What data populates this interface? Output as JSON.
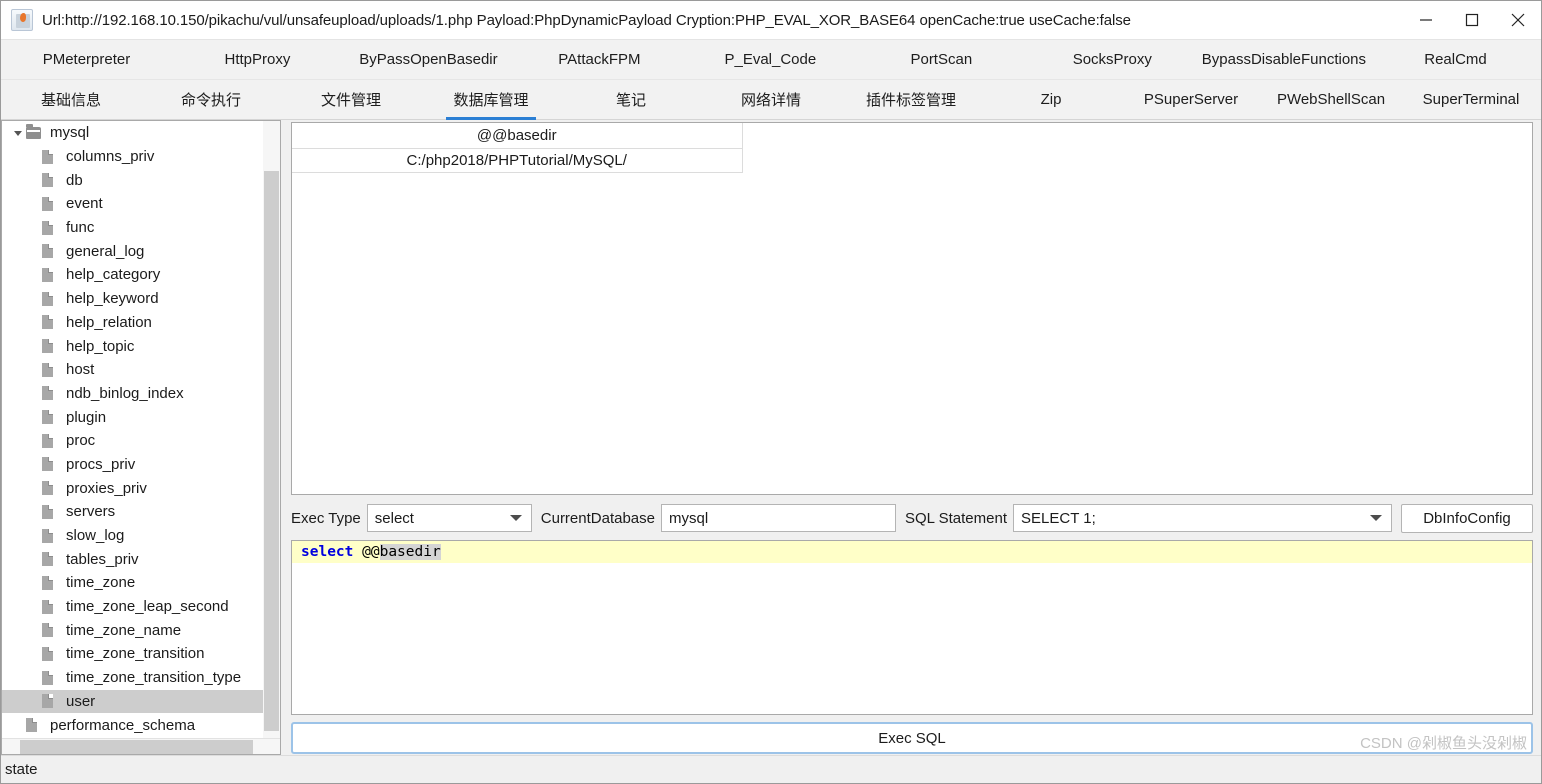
{
  "window": {
    "title": "Url:http://192.168.10.150/pikachu/vul/unsafeupload/uploads/1.php Payload:PhpDynamicPayload Cryption:PHP_EVAL_XOR_BASE64 openCache:true useCache:false",
    "app_icon": "java-coffee-cup-icon",
    "minimize_label": "minimize-icon",
    "maximize_label": "maximize-icon",
    "close_label": "close-icon"
  },
  "tabs_row1": [
    {
      "label": "PMeterpreter",
      "selected": false
    },
    {
      "label": "HttpProxy",
      "selected": false
    },
    {
      "label": "ByPassOpenBasedir",
      "selected": false
    },
    {
      "label": "PAttackFPM",
      "selected": false
    },
    {
      "label": "P_Eval_Code",
      "selected": false
    },
    {
      "label": "PortScan",
      "selected": false
    },
    {
      "label": "SocksProxy",
      "selected": false
    },
    {
      "label": "BypassDisableFunctions",
      "selected": false
    },
    {
      "label": "RealCmd",
      "selected": false
    }
  ],
  "tabs_row2": [
    {
      "label": "基础信息",
      "selected": false
    },
    {
      "label": "命令执行",
      "selected": false
    },
    {
      "label": "文件管理",
      "selected": false
    },
    {
      "label": "数据库管理",
      "selected": true
    },
    {
      "label": "笔记",
      "selected": false
    },
    {
      "label": "网络详情",
      "selected": false
    },
    {
      "label": "插件标签管理",
      "selected": false
    },
    {
      "label": "Zip",
      "selected": false
    },
    {
      "label": "PSuperServer",
      "selected": false
    },
    {
      "label": "PWebShellScan",
      "selected": false
    },
    {
      "label": "SuperTerminal",
      "selected": false
    }
  ],
  "tree": {
    "nodes": [
      {
        "label": "mysql",
        "depth": 0,
        "icon": "folder-open-icon",
        "expanded": true,
        "selected": false
      },
      {
        "label": "columns_priv",
        "depth": 1,
        "icon": "table-icon",
        "selected": false
      },
      {
        "label": "db",
        "depth": 1,
        "icon": "table-icon",
        "selected": false
      },
      {
        "label": "event",
        "depth": 1,
        "icon": "table-icon",
        "selected": false
      },
      {
        "label": "func",
        "depth": 1,
        "icon": "table-icon",
        "selected": false
      },
      {
        "label": "general_log",
        "depth": 1,
        "icon": "table-icon",
        "selected": false
      },
      {
        "label": "help_category",
        "depth": 1,
        "icon": "table-icon",
        "selected": false
      },
      {
        "label": "help_keyword",
        "depth": 1,
        "icon": "table-icon",
        "selected": false
      },
      {
        "label": "help_relation",
        "depth": 1,
        "icon": "table-icon",
        "selected": false
      },
      {
        "label": "help_topic",
        "depth": 1,
        "icon": "table-icon",
        "selected": false
      },
      {
        "label": "host",
        "depth": 1,
        "icon": "table-icon",
        "selected": false
      },
      {
        "label": "ndb_binlog_index",
        "depth": 1,
        "icon": "table-icon",
        "selected": false
      },
      {
        "label": "plugin",
        "depth": 1,
        "icon": "table-icon",
        "selected": false
      },
      {
        "label": "proc",
        "depth": 1,
        "icon": "table-icon",
        "selected": false
      },
      {
        "label": "procs_priv",
        "depth": 1,
        "icon": "table-icon",
        "selected": false
      },
      {
        "label": "proxies_priv",
        "depth": 1,
        "icon": "table-icon",
        "selected": false
      },
      {
        "label": "servers",
        "depth": 1,
        "icon": "table-icon",
        "selected": false
      },
      {
        "label": "slow_log",
        "depth": 1,
        "icon": "table-icon",
        "selected": false
      },
      {
        "label": "tables_priv",
        "depth": 1,
        "icon": "table-icon",
        "selected": false
      },
      {
        "label": "time_zone",
        "depth": 1,
        "icon": "table-icon",
        "selected": false
      },
      {
        "label": "time_zone_leap_second",
        "depth": 1,
        "icon": "table-icon",
        "selected": false
      },
      {
        "label": "time_zone_name",
        "depth": 1,
        "icon": "table-icon",
        "selected": false
      },
      {
        "label": "time_zone_transition",
        "depth": 1,
        "icon": "table-icon",
        "selected": false
      },
      {
        "label": "time_zone_transition_type",
        "depth": 1,
        "icon": "table-icon",
        "selected": false
      },
      {
        "label": "user",
        "depth": 1,
        "icon": "table-icon",
        "selected": true
      },
      {
        "label": "performance_schema",
        "depth": 0,
        "icon": "database-icon",
        "selected": false
      }
    ]
  },
  "results": {
    "columns": [
      "@@basedir",
      ""
    ],
    "rows": [
      [
        "C:/php2018/PHPTutorial/MySQL/",
        ""
      ]
    ]
  },
  "controls": {
    "exec_type_label": "Exec Type",
    "exec_type_value": "select",
    "current_database_label": "CurrentDatabase",
    "current_database_value": "mysql",
    "sql_statement_label": "SQL Statement",
    "sql_statement_value": "SELECT 1;",
    "dbinfo_button": "DbInfoConfig"
  },
  "sql_editor": {
    "keyword": "select",
    "operator": " @@",
    "identifier": "basedir"
  },
  "exec_button": {
    "label": "Exec SQL"
  },
  "watermark": {
    "text": "CSDN @剁椒鱼头没剁椒"
  },
  "statusbar": {
    "text": "state"
  },
  "colors": {
    "accent": "#2b7fd4",
    "focus_border": "#9cc3e8",
    "editor_line_highlight": "#ffffc8",
    "keyword": "#0000e0",
    "selection": "#cdcdcd"
  }
}
